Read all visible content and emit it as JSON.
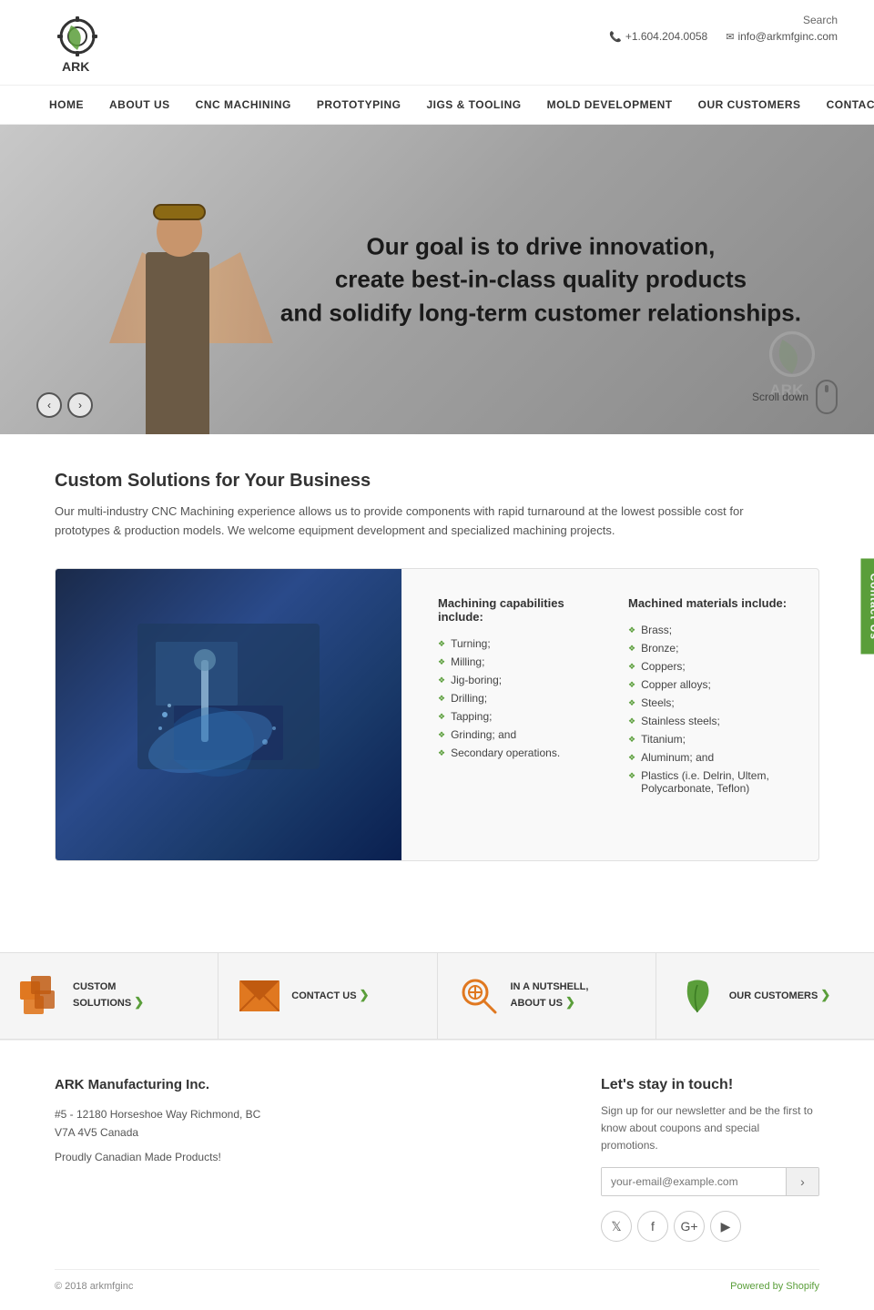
{
  "header": {
    "search_label": "Search",
    "phone": "+1.604.204.0058",
    "email": "info@arkmfginc.com",
    "logo_text": "ARK"
  },
  "nav": {
    "items": [
      {
        "label": "HOME",
        "key": "home"
      },
      {
        "label": "ABOUT US",
        "key": "about"
      },
      {
        "label": "CNC MACHINING",
        "key": "cnc"
      },
      {
        "label": "PROTOTYPING",
        "key": "prototyping"
      },
      {
        "label": "JIGS & TOOLING",
        "key": "jigs"
      },
      {
        "label": "MOLD DEVELOPMENT",
        "key": "mold"
      },
      {
        "label": "OUR CUSTOMERS",
        "key": "customers"
      },
      {
        "label": "CONTACT US",
        "key": "contact"
      }
    ]
  },
  "hero": {
    "tagline_line1": "Our goal is to drive innovation,",
    "tagline_line2": "create best-in-class quality products",
    "tagline_line3": "and solidify long-term customer relationships.",
    "scroll_label": "Scroll down",
    "prev_label": "‹",
    "next_label": "›"
  },
  "contact_side_tab": "Contact Us",
  "main": {
    "section_title": "Custom Solutions for Your Business",
    "section_desc": "Our multi-industry CNC Machining experience allows us to provide components with rapid turnaround at the lowest possible cost for prototypes & production models.  We welcome equipment development and specialized machining projects.",
    "capabilities": {
      "machining_title": "Machining capabilities include:",
      "machining_items": [
        "Turning;",
        "Milling;",
        "Jig-boring;",
        "Drilling;",
        "Tapping;",
        "Grinding; and",
        "Secondary operations."
      ],
      "materials_title": "Machined materials include:",
      "materials_items": [
        "Brass;",
        "Bronze;",
        "Coppers;",
        "Copper alloys;",
        "Steels;",
        "Stainless steels;",
        "Titanium;",
        "Aluminum; and",
        "Plastics (i.e. Delrin, Ultem, Polycarbonate, Teflon)"
      ]
    }
  },
  "tiles": [
    {
      "label": "CUSTOM\nSOLUTIONS",
      "arrow": "❯",
      "icon": "boxes"
    },
    {
      "label": "CONTACT US",
      "arrow": "❯",
      "icon": "envelope"
    },
    {
      "label": "IN A NUTSHELL,\nABOUT US",
      "arrow": "❯",
      "icon": "magnify"
    },
    {
      "label": "OUR CUSTOMERS",
      "arrow": "❯",
      "icon": "leaf"
    }
  ],
  "footer": {
    "company_name": "ARK Manufacturing Inc.",
    "address_line1": "#5 - 12180 Horseshoe Way Richmond, BC",
    "address_line2": "V7A 4V5 Canada",
    "canadian_made": "Proudly Canadian Made Products!",
    "newsletter_title": "Let's stay in touch!",
    "newsletter_desc": "Sign up for our newsletter and be the first to know about coupons and special promotions.",
    "email_placeholder": "your-email@example.com",
    "social": {
      "twitter": "𝕏",
      "facebook": "f",
      "google": "G",
      "youtube": "▶"
    },
    "copyright": "© 2018 arkmfginc",
    "powered_by": "Powered by Shopify"
  }
}
